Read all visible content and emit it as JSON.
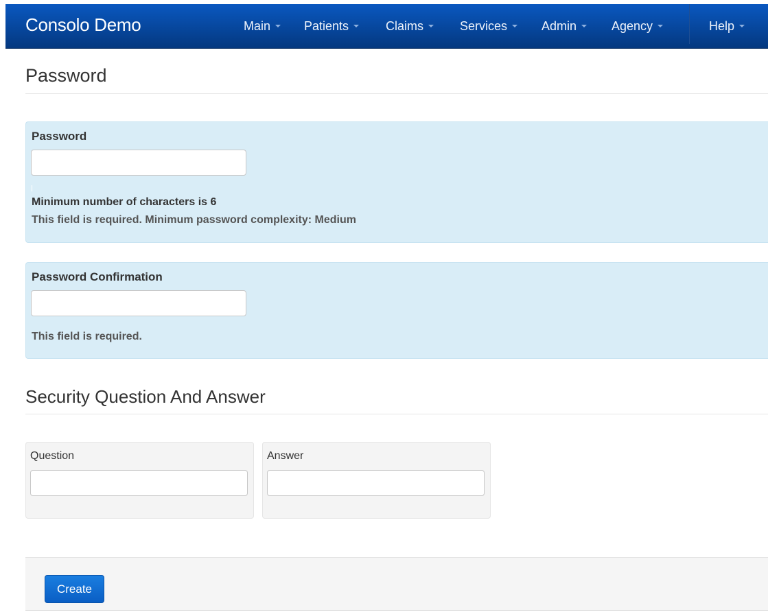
{
  "navbar": {
    "brand": "Consolo Demo",
    "items": [
      {
        "label": "Main"
      },
      {
        "label": "Patients"
      },
      {
        "label": "Claims"
      },
      {
        "label": "Services"
      },
      {
        "label": "Admin"
      },
      {
        "label": "Agency"
      },
      {
        "label": "Help"
      }
    ]
  },
  "password_section": {
    "title": "Password",
    "password": {
      "label": "Password",
      "value": "",
      "hint_min_chars": "Minimum number of characters is 6",
      "hint_required": "This field is required. Minimum password complexity: Medium"
    },
    "confirmation": {
      "label": "Password Confirmation",
      "value": "",
      "hint_required": "This field is required."
    }
  },
  "security_section": {
    "title": "Security Question And Answer",
    "question": {
      "label": "Question",
      "value": ""
    },
    "answer": {
      "label": "Answer",
      "value": ""
    }
  },
  "actions": {
    "create_label": "Create"
  },
  "colors": {
    "navbar": "#0a4ea8",
    "info_panel": "#d9edf7",
    "primary_button": "#0a66cc"
  }
}
